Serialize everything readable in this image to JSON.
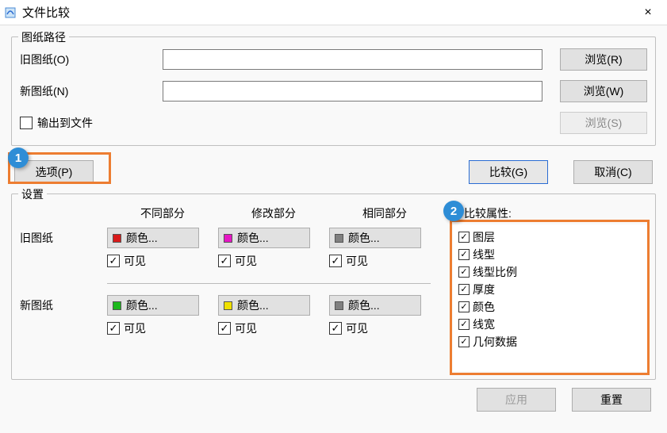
{
  "window": {
    "title": "文件比较",
    "close_label": "×"
  },
  "paths_group": {
    "legend": "图纸路径",
    "old_drawing_label": "旧图纸(O)",
    "new_drawing_label": "新图纸(N)",
    "output_to_file_label": "输出到文件",
    "browse_r": "浏览(R)",
    "browse_w": "浏览(W)",
    "browse_s": "浏览(S)",
    "old_value": "",
    "new_value": ""
  },
  "midbar": {
    "options_btn": "选项(P)",
    "compare_btn": "比较(G)",
    "cancel_btn": "取消(C)"
  },
  "annotations": {
    "badge1": "1",
    "badge2": "2"
  },
  "settings": {
    "legend": "设置",
    "col_diff": "不同部分",
    "col_mod": "修改部分",
    "col_same": "相同部分",
    "row_old": "旧图纸",
    "row_new": "新图纸",
    "color_label": "颜色...",
    "visible_label": "可见",
    "compare_attrs_label": "比较属性:",
    "attrs": [
      "图层",
      "线型",
      "线型比例",
      "厚度",
      "颜色",
      "线宽",
      "几何数据"
    ]
  },
  "colors": {
    "old_diff": "#d81a1a",
    "old_mod": "#e617c4",
    "old_same": "#808080",
    "new_diff": "#1cb81c",
    "new_mod": "#f0e000",
    "new_same": "#808080"
  },
  "bottom": {
    "apply": "应用",
    "reset": "重置"
  }
}
